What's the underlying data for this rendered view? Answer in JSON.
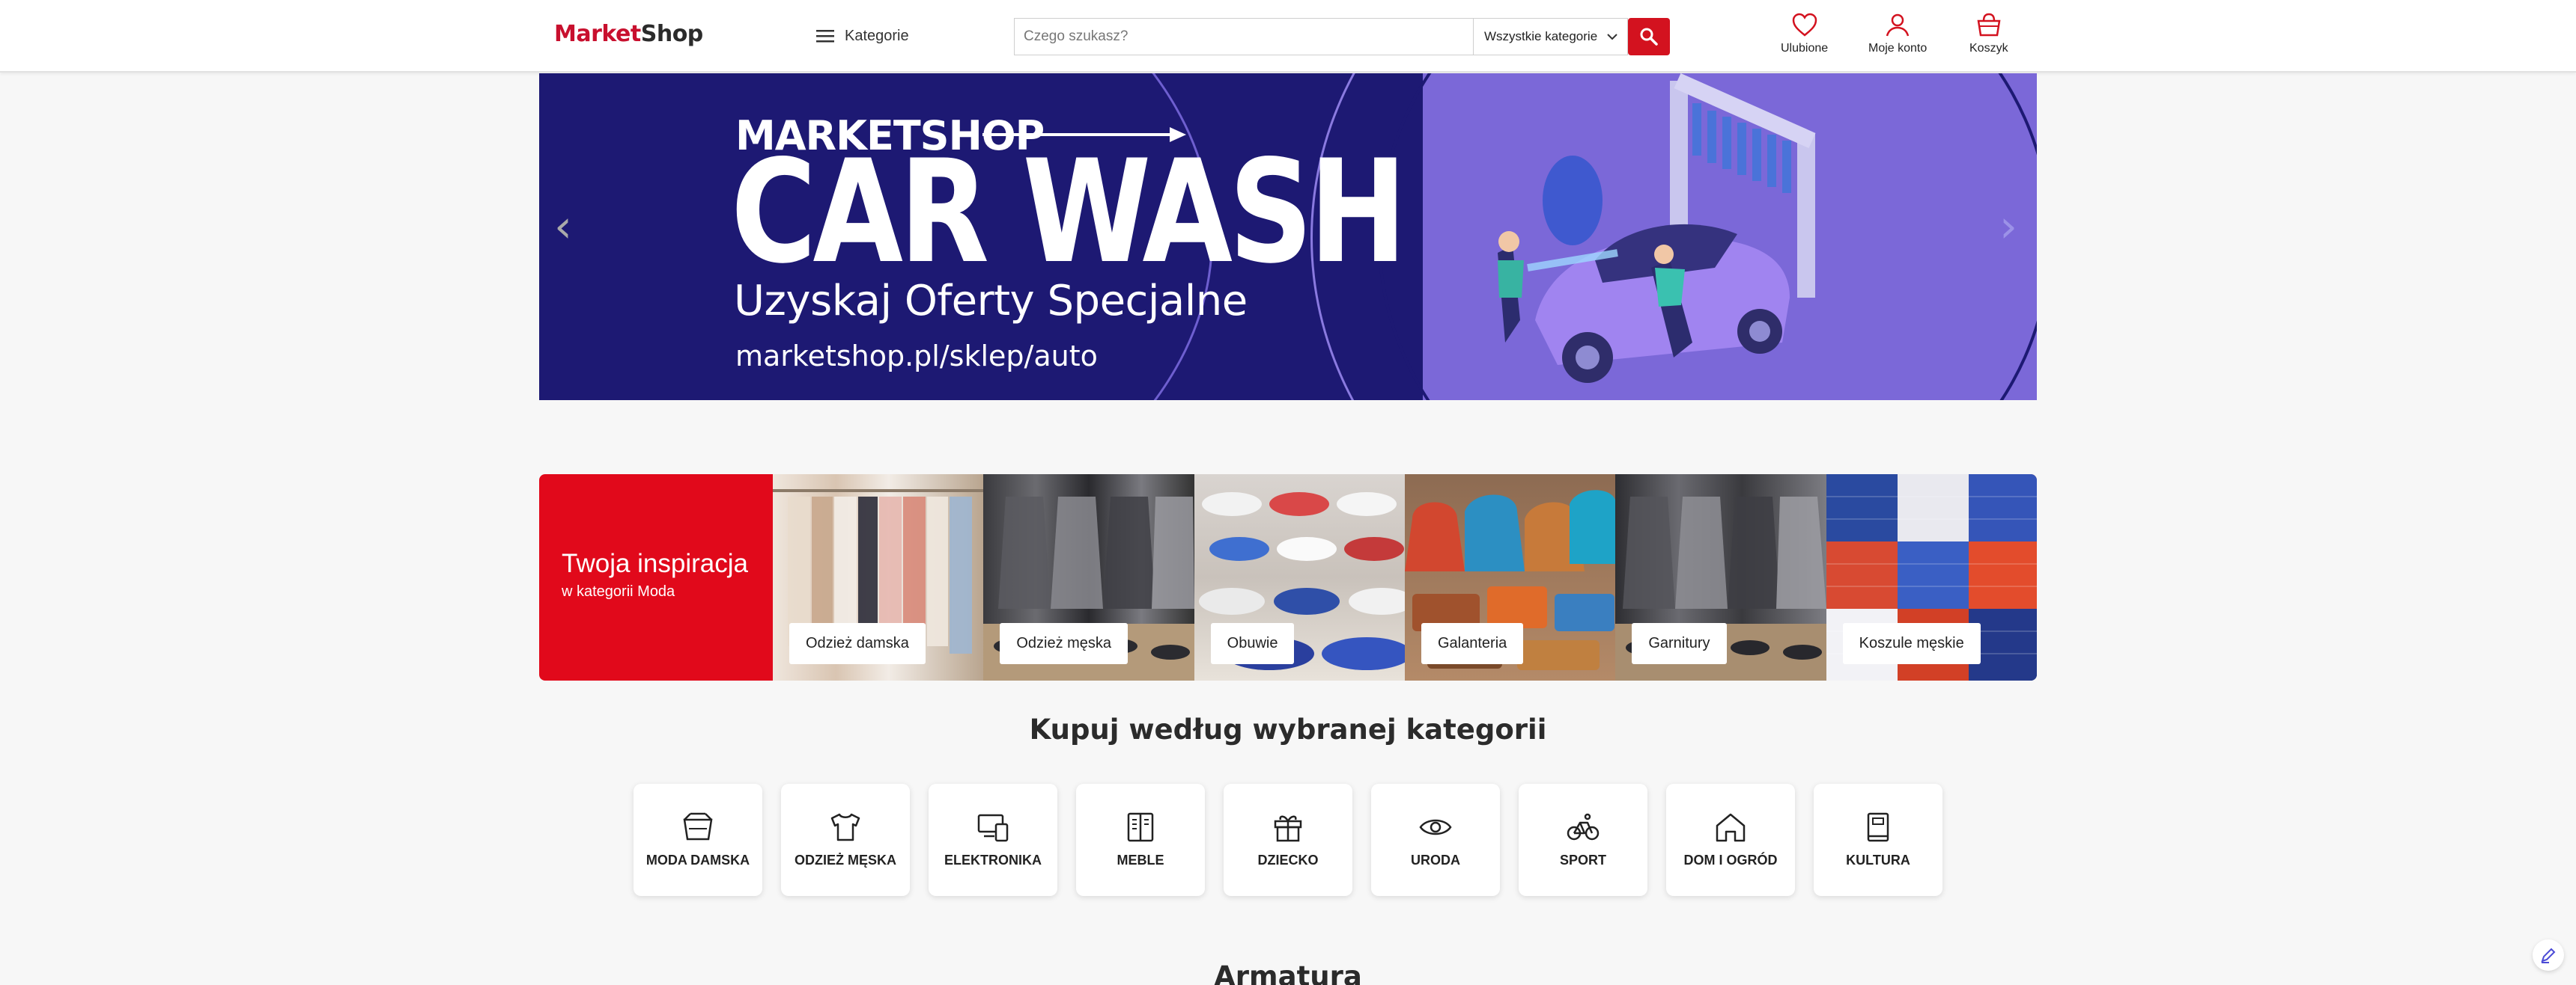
{
  "header": {
    "logo_part1": "Market",
    "logo_part2": "Shop",
    "categories_label": "Kategorie",
    "search_placeholder": "Czego szukasz?",
    "category_select": "Wszystkie kategorie",
    "links": {
      "favorites": "Ulubione",
      "account": "Moje konto",
      "cart": "Koszyk"
    },
    "accent_color": "#d3121f"
  },
  "banner": {
    "brand": "MARKETSHOP",
    "title": "CAR WASH",
    "subtitle": "Uzyskaj Oferty Specjalne",
    "url": "marketshop.pl/sklep/auto",
    "prev_icon": "chevron-left-icon",
    "next_icon": "chevron-right-icon",
    "colors": {
      "dark": "#1d1973",
      "light": "#7b68d8"
    }
  },
  "inspiration": {
    "heading": "Twoja inspiracja",
    "subheading": "w kategorii Moda",
    "tiles": [
      "Odzież damska",
      "Odzież męska",
      "Obuwie",
      "Galanteria",
      "Garnitury",
      "Koszule męskie"
    ]
  },
  "shop_by_category": {
    "heading": "Kupuj według wybranej kategorii",
    "items": [
      {
        "label": "MODA DAMSKA",
        "icon": "basket-icon"
      },
      {
        "label": "ODZIEŻ MĘSKA",
        "icon": "tshirt-icon"
      },
      {
        "label": "ELEKTRONIKA",
        "icon": "devices-icon"
      },
      {
        "label": "MEBLE",
        "icon": "wardrobe-icon"
      },
      {
        "label": "DZIECKO",
        "icon": "gift-icon"
      },
      {
        "label": "URODA",
        "icon": "eye-icon"
      },
      {
        "label": "SPORT",
        "icon": "bicycle-icon"
      },
      {
        "label": "DOM I OGRÓD",
        "icon": "house-icon"
      },
      {
        "label": "KULTURA",
        "icon": "book-icon"
      }
    ]
  },
  "next_section": {
    "heading": "Armatura"
  }
}
